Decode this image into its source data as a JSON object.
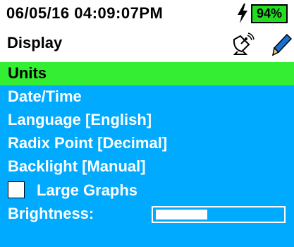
{
  "status": {
    "timestamp": "06/05/16 04:09:07PM",
    "battery": "94%",
    "bolt_icon": "charging-bolt-icon"
  },
  "header": {
    "title": "Display",
    "icons": [
      "satellite-dish-icon",
      "pen-icon"
    ]
  },
  "menu": {
    "items": [
      {
        "label": "Units",
        "selected": true
      },
      {
        "label": "Date/Time"
      },
      {
        "label": "Language [English]"
      },
      {
        "label": "Radix Point [Decimal]"
      },
      {
        "label": "Backlight [Manual]"
      }
    ],
    "large_graphs": {
      "label": "Large Graphs",
      "checked": false
    },
    "brightness": {
      "label": "Brightness:",
      "level_fraction": 0.41
    }
  },
  "colors": {
    "menu_bg": "#00aaff",
    "selected_bg": "#33ee33",
    "battery": "#22dd22"
  }
}
